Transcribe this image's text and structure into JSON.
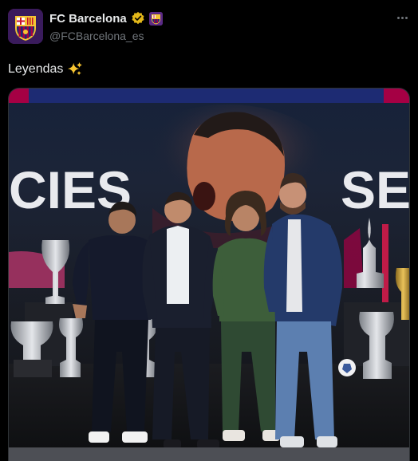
{
  "account": {
    "display_name": "FC Barcelona",
    "handle": "@FCBarcelona_es"
  },
  "tweet": {
    "text": "Leyendas"
  },
  "media": {
    "banner_left_text": "CIES",
    "banner_right_text": "SE"
  },
  "icons": {
    "avatar": "fc-barcelona-crest-icon",
    "verified": "gold-verified-badge-icon",
    "affiliate": "affiliate-badge-icon",
    "more": "more-options-icon",
    "sparkle": "sparkles-emoji-icon"
  },
  "colors": {
    "background": "#000000",
    "text_primary": "#e7e9ea",
    "text_secondary": "#71767b",
    "verified_gold": "#e2b719",
    "barca_blue": "#1d2b73",
    "barca_garnet": "#a50044"
  }
}
